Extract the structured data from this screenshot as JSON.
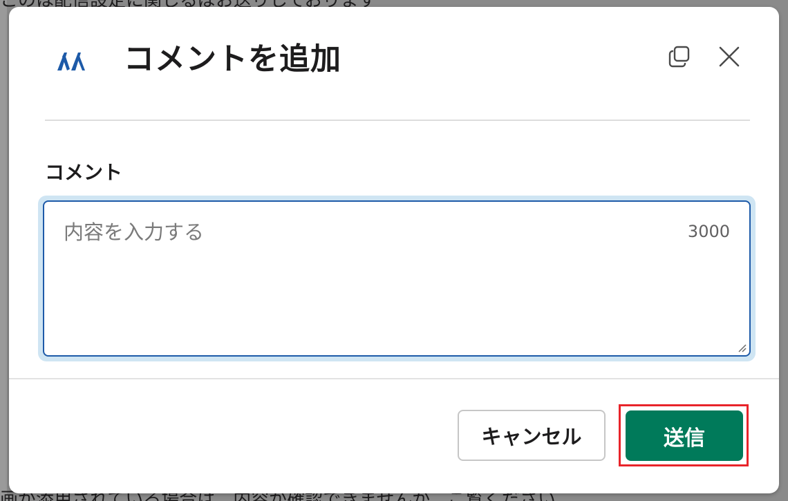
{
  "background": {
    "top_text": "このは配信設定に関しるばお送りしております",
    "bottom_text": "画が添用されている場合は、内容が確認できませんが、ご覧ください"
  },
  "modal": {
    "title": "コメントを追加",
    "logo_icon": "app-logo-icon",
    "copy_icon": "copy-icon",
    "close_icon": "close-icon"
  },
  "comment_field": {
    "label": "コメント",
    "placeholder": "内容を入力する",
    "value": "",
    "char_limit": "3000"
  },
  "footer": {
    "cancel_label": "キャンセル",
    "send_label": "送信"
  },
  "colors": {
    "send_button": "#007a5a",
    "focus_border": "#1d5aa8",
    "focus_glow": "#cfe5f3",
    "highlight": "#e8242a",
    "logo": "#1d5aa8"
  }
}
